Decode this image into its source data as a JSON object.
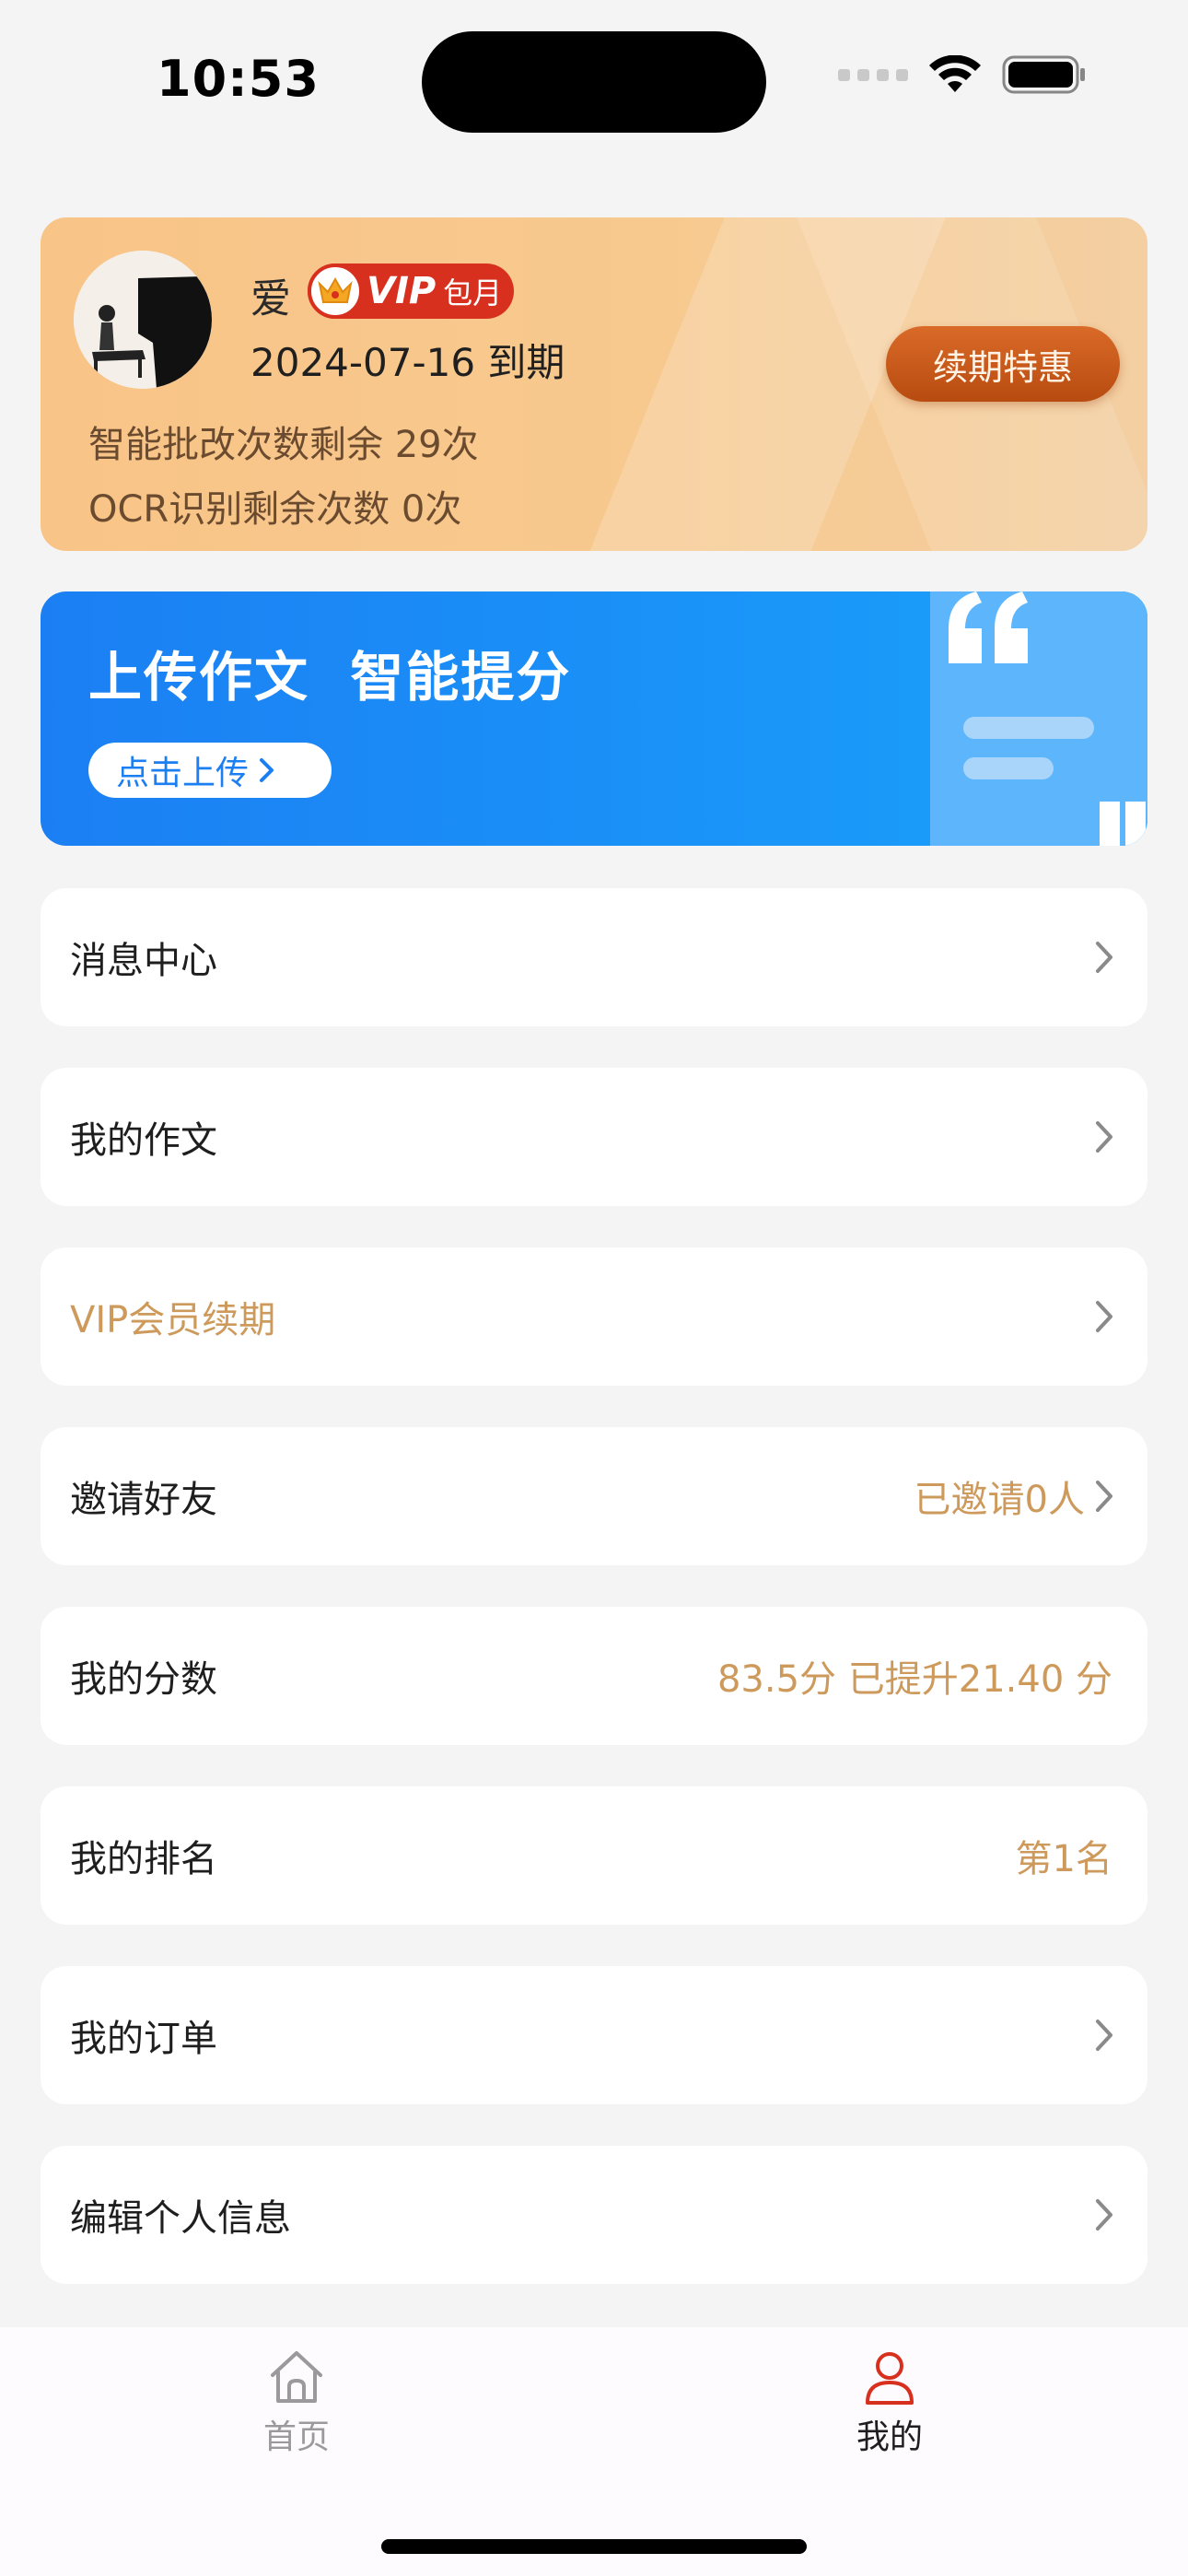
{
  "status_bar": {
    "time": "10:53"
  },
  "profile": {
    "name": "爱",
    "vip_label": "VIP",
    "vip_plan": "包月",
    "expiry": "2024-07-16 到期",
    "correction_quota": "智能批改次数剩余 29次",
    "ocr_quota": "OCR识别剩余次数 0次",
    "renew_button": "续期特惠"
  },
  "banner": {
    "title": "上传作文  智能提分",
    "button": "点击上传"
  },
  "menu": {
    "messages": {
      "label": "消息中心"
    },
    "essays": {
      "label": "我的作文"
    },
    "vip_renew": {
      "label": "VIP会员续期"
    },
    "invite": {
      "label": "邀请好友",
      "value": "已邀请0人"
    },
    "score": {
      "label": "我的分数",
      "value": "83.5分 已提升21.40 分"
    },
    "rank": {
      "label": "我的排名",
      "value": "第1名"
    },
    "orders": {
      "label": "我的订单"
    },
    "edit_profile": {
      "label": "编辑个人信息"
    }
  },
  "tab_bar": {
    "home": {
      "label": "首页",
      "icon": "home-icon"
    },
    "mine": {
      "label": "我的",
      "icon": "person-icon",
      "active": true
    }
  },
  "colors": {
    "accent_gold": "#cd9a5c",
    "active_tab": "#d8301f",
    "banner_blue": "#1b7ff3"
  }
}
